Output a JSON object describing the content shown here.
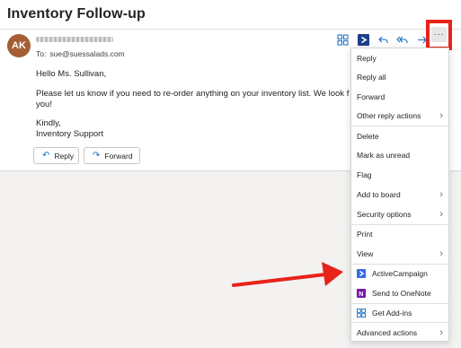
{
  "email": {
    "subject": "Inventory Follow-up",
    "avatar_initials": "AK",
    "to_label": "To:",
    "to_address": "sue@suessalads.com",
    "greeting": "Hello Ms. Sullivan,",
    "body_line1": "Please let us know if you need to re-order anything on your inventory list. We look f",
    "body_line2": "you!",
    "closing1": "Kindly,",
    "closing2": "Inventory Support"
  },
  "actions": {
    "reply_label": "Reply",
    "forward_label": "Forward"
  },
  "toolbar": {
    "icons": [
      "apps-grid-icon",
      "activecampaign-icon",
      "reply-icon",
      "reply-all-icon",
      "forward-icon",
      "more-options-icon"
    ],
    "more_glyph": "···"
  },
  "menu": {
    "items": [
      {
        "label": "Reply",
        "chevron": ""
      },
      {
        "label": "Reply all",
        "chevron": ""
      },
      {
        "label": "Forward",
        "chevron": ""
      },
      {
        "label": "Other reply actions",
        "chevron": "›"
      },
      {
        "label": "Delete",
        "chevron": ""
      },
      {
        "label": "Mark as unread",
        "chevron": ""
      },
      {
        "label": "Flag",
        "chevron": ""
      },
      {
        "label": "Add to board",
        "chevron": "›"
      },
      {
        "label": "Security options",
        "chevron": "›"
      },
      {
        "label": "Print",
        "chevron": ""
      },
      {
        "label": "View",
        "chevron": "›"
      },
      {
        "label": "ActiveCampaign",
        "chevron": ""
      },
      {
        "label": "Send to OneNote",
        "chevron": ""
      },
      {
        "label": "Get Add-ins",
        "chevron": ""
      },
      {
        "label": "Advanced actions",
        "chevron": "›"
      }
    ]
  },
  "colors": {
    "accent": "#0f6cbd",
    "highlight": "#e8231a",
    "avatar": "#a55d32",
    "activecampaign": "#356ae6",
    "onenote": "#7719aa"
  }
}
